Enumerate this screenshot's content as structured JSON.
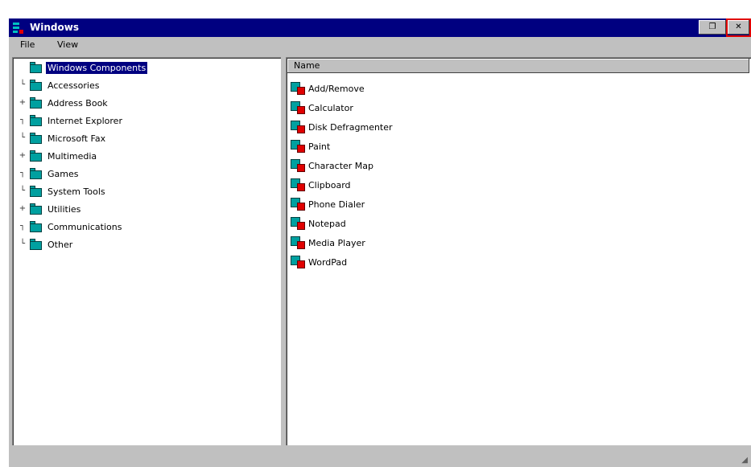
{
  "window": {
    "title": "Windows",
    "restore_label": "❐",
    "close_label": "✕"
  },
  "menu": {
    "items": [
      "File",
      "View"
    ]
  },
  "tree": {
    "items": [
      {
        "label": "Windows Components",
        "expander": "",
        "selected": true
      },
      {
        "label": "Accessories",
        "expander": "└"
      },
      {
        "label": "Address Book",
        "expander": "+"
      },
      {
        "label": "Internet Explorer",
        "expander": "┐"
      },
      {
        "label": "Microsoft Fax",
        "expander": "└"
      },
      {
        "label": "Multimedia",
        "expander": "+"
      },
      {
        "label": "Games",
        "expander": "┐"
      },
      {
        "label": "System Tools",
        "expander": "└"
      },
      {
        "label": "Utilities",
        "expander": "+"
      },
      {
        "label": "Communications",
        "expander": "┐"
      },
      {
        "label": "Other",
        "expander": "└"
      }
    ]
  },
  "list": {
    "header": "Name",
    "items": [
      "Add/Remove",
      "Calculator",
      "Disk Defragmenter",
      "Paint",
      "Character Map",
      "Clipboard",
      "Phone Dialer",
      "Notepad",
      "Media Player",
      "WordPad"
    ]
  }
}
